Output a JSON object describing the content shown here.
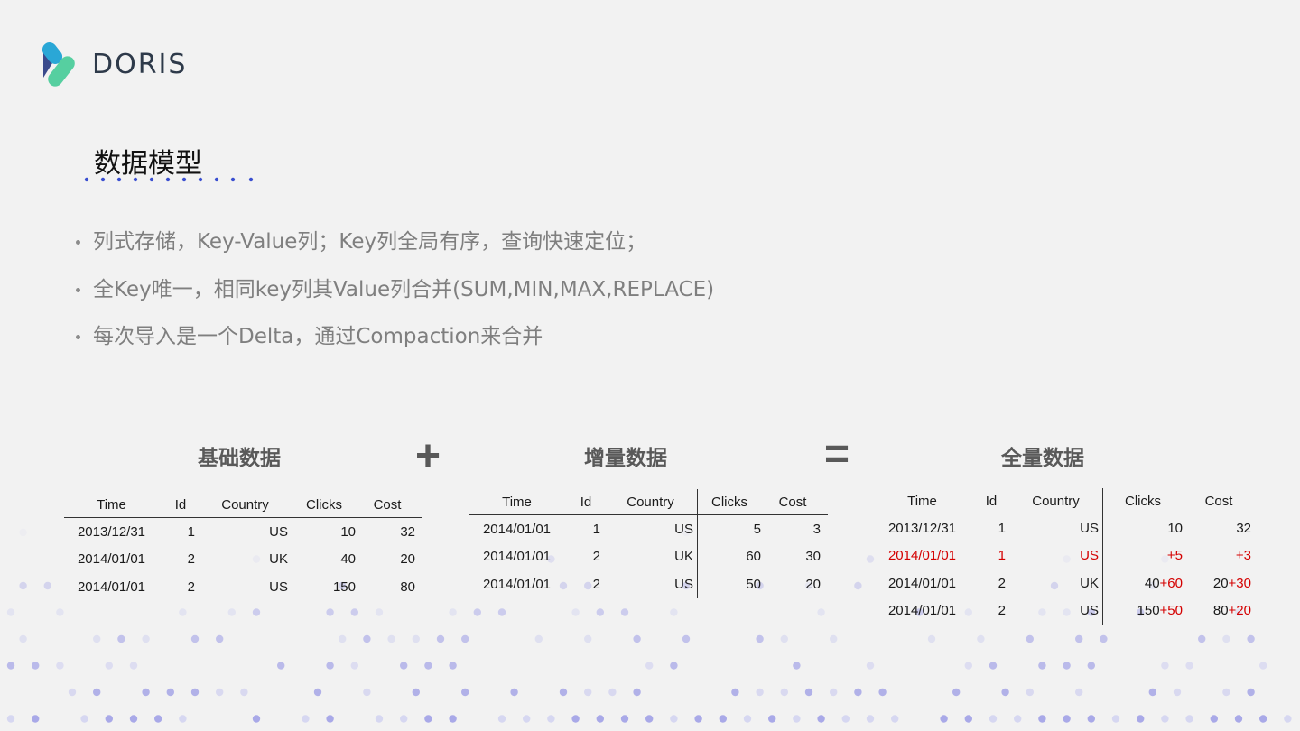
{
  "logo": {
    "text": "DORIS"
  },
  "title": "数据模型",
  "bullets": [
    "列式存储，Key-Value列；Key列全局有序，查询快速定位；",
    "全Key唯一，相同key列其Value列合并(SUM,MIN,MAX,REPLACE)",
    "每次导入是一个Delta，通过Compaction来合并"
  ],
  "operators": {
    "plus": "+",
    "equals": "="
  },
  "tables": {
    "base": {
      "title": "基础数据",
      "headers": [
        "Time",
        "Id",
        "Country",
        "Clicks",
        "Cost"
      ],
      "rows": [
        [
          "2013/12/31",
          "1",
          "US",
          "10",
          "32"
        ],
        [
          "2014/01/01",
          "2",
          "UK",
          "40",
          "20"
        ],
        [
          "2014/01/01",
          "2",
          "US",
          "150",
          "80"
        ]
      ]
    },
    "delta": {
      "title": "增量数据",
      "headers": [
        "Time",
        "Id",
        "Country",
        "Clicks",
        "Cost"
      ],
      "rows": [
        [
          "2014/01/01",
          "1",
          "US",
          "5",
          "3"
        ],
        [
          "2014/01/01",
          "2",
          "UK",
          "60",
          "30"
        ],
        [
          "2014/01/01",
          "2",
          "US",
          "50",
          "20"
        ]
      ]
    },
    "full": {
      "title": "全量数据",
      "headers": [
        "Time",
        "Id",
        "Country",
        "Clicks",
        "Cost"
      ],
      "rows": [
        {
          "time": "2013/12/31",
          "id": "1",
          "country": "US",
          "clicks": "10",
          "clicks_add": "",
          "cost": "32",
          "cost_add": ""
        },
        {
          "time": "2014/01/01",
          "id": "1",
          "country": "US",
          "clicks": "",
          "clicks_add": "+5",
          "cost": "",
          "cost_add": "+3"
        },
        {
          "time": "2014/01/01",
          "id": "2",
          "country": "UK",
          "clicks": "40",
          "clicks_add": "+60",
          "cost": "20",
          "cost_add": "+30"
        },
        {
          "time": "2014/01/01",
          "id": "2",
          "country": "US",
          "clicks": "150",
          "clicks_add": "+50",
          "cost": "80",
          "cost_add": "+20"
        }
      ]
    }
  },
  "colors": {
    "accent_dots": "#3a4fd0",
    "highlight_red": "#d40000",
    "logo_blue": "#2aa7d6",
    "logo_green": "#56cfa0",
    "logo_navy": "#3a4a8c"
  }
}
